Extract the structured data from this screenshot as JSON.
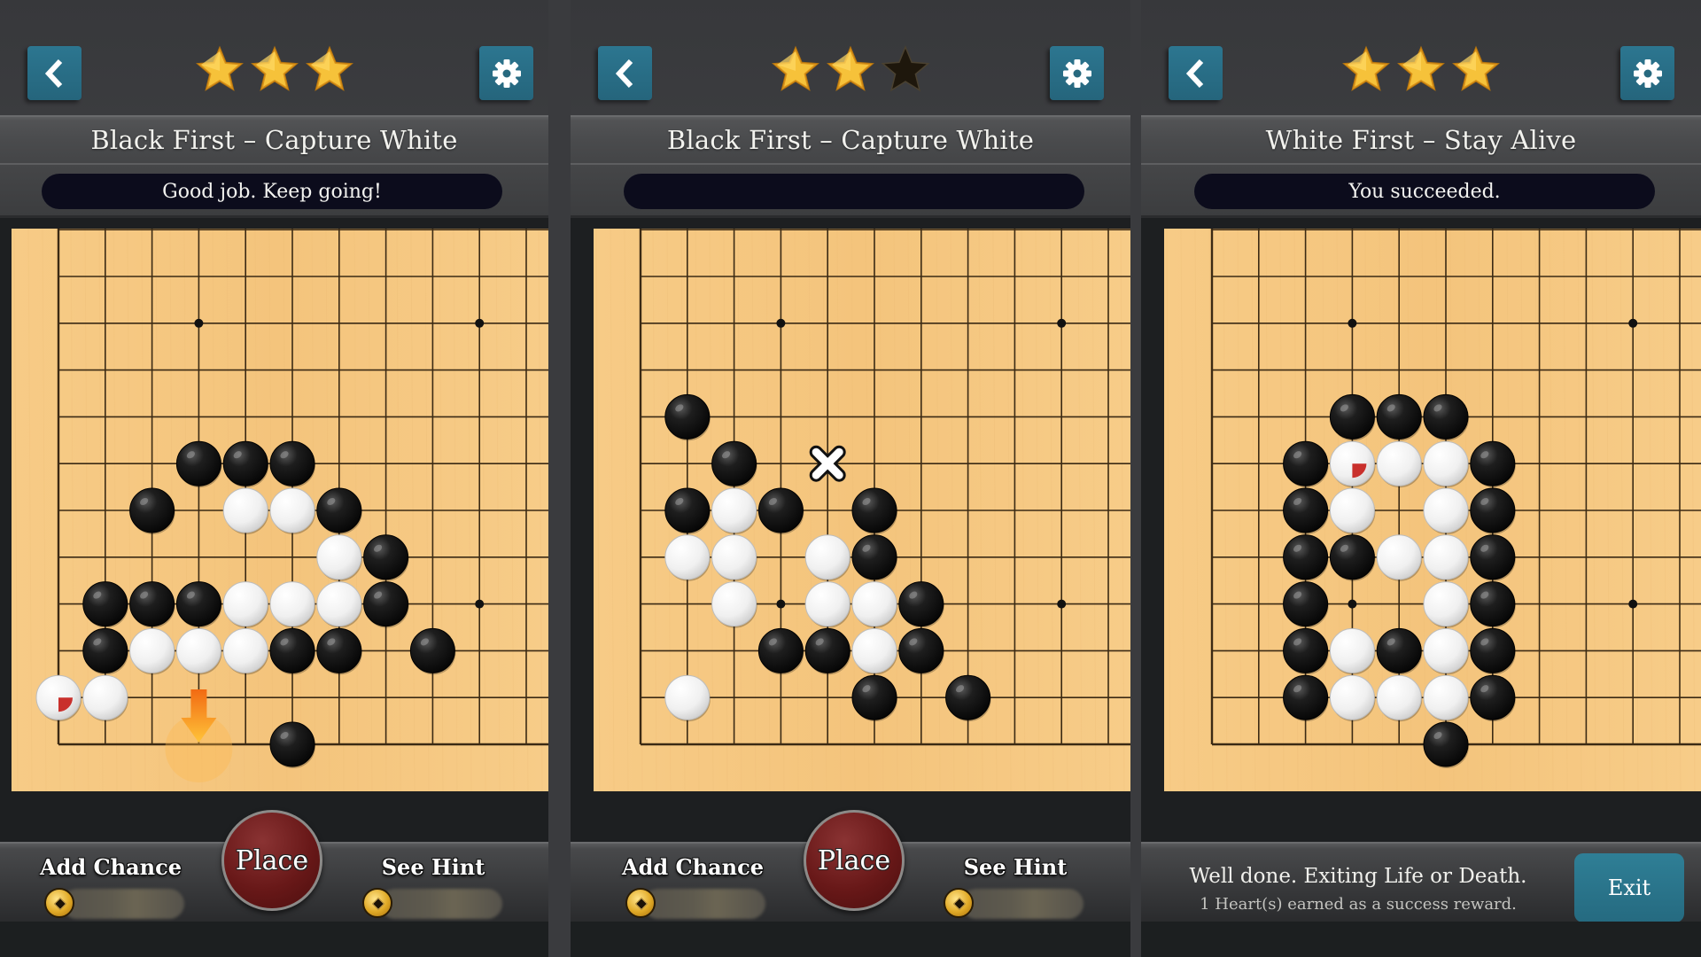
{
  "colors": {
    "accent_button": "#2a6f88",
    "place_button": "#681818",
    "board_wood": "#f6c982",
    "message_pill": "#0c0c1c",
    "star_gold": "#f3b52b",
    "star_empty": "#1e170c"
  },
  "board_size_visible": {
    "columns": 11,
    "rows": 12
  },
  "panels": [
    {
      "back_icon": "chevron-left-icon",
      "settings_icon": "gear-icon",
      "stars": {
        "earned": 3,
        "total": 3
      },
      "title": "Black First – Capture White",
      "message": "Good job. Keep going!",
      "star_points": [
        [
          3,
          9
        ],
        [
          9,
          9
        ],
        [
          9,
          3
        ]
      ],
      "stones": [
        {
          "color": "black",
          "col": 3,
          "row": 6
        },
        {
          "color": "black",
          "col": 4,
          "row": 6
        },
        {
          "color": "black",
          "col": 5,
          "row": 6
        },
        {
          "color": "black",
          "col": 2,
          "row": 5
        },
        {
          "color": "white",
          "col": 4,
          "row": 5
        },
        {
          "color": "white",
          "col": 5,
          "row": 5
        },
        {
          "color": "black",
          "col": 6,
          "row": 5
        },
        {
          "color": "white",
          "col": 6,
          "row": 4
        },
        {
          "color": "black",
          "col": 7,
          "row": 4
        },
        {
          "color": "black",
          "col": 1,
          "row": 3
        },
        {
          "color": "black",
          "col": 2,
          "row": 3
        },
        {
          "color": "black",
          "col": 3,
          "row": 3
        },
        {
          "color": "white",
          "col": 4,
          "row": 3
        },
        {
          "color": "white",
          "col": 5,
          "row": 3
        },
        {
          "color": "white",
          "col": 6,
          "row": 3
        },
        {
          "color": "black",
          "col": 7,
          "row": 3
        },
        {
          "color": "black",
          "col": 1,
          "row": 2
        },
        {
          "color": "white",
          "col": 2,
          "row": 2
        },
        {
          "color": "white",
          "col": 3,
          "row": 2
        },
        {
          "color": "white",
          "col": 4,
          "row": 2
        },
        {
          "color": "black",
          "col": 5,
          "row": 2
        },
        {
          "color": "black",
          "col": 6,
          "row": 2
        },
        {
          "color": "black",
          "col": 8,
          "row": 2
        },
        {
          "color": "white",
          "col": 0,
          "row": 1,
          "last_move": true
        },
        {
          "color": "white",
          "col": 1,
          "row": 1
        },
        {
          "color": "black",
          "col": 5,
          "row": 0
        }
      ],
      "markers": [
        {
          "type": "hint-arrow",
          "col": 3,
          "row": 0
        }
      ],
      "controls": {
        "add_chance_label": "Add Chance",
        "place_label": "Place",
        "see_hint_label": "See Hint"
      }
    },
    {
      "back_icon": "chevron-left-icon",
      "settings_icon": "gear-icon",
      "stars": {
        "earned": 2,
        "total": 3
      },
      "title": "Black First – Capture White",
      "message": "",
      "star_points": [
        [
          3,
          9
        ],
        [
          9,
          9
        ],
        [
          3,
          3
        ],
        [
          9,
          3
        ]
      ],
      "stones": [
        {
          "color": "black",
          "col": 1,
          "row": 7
        },
        {
          "color": "black",
          "col": 2,
          "row": 6
        },
        {
          "color": "black",
          "col": 1,
          "row": 5
        },
        {
          "color": "white",
          "col": 2,
          "row": 5
        },
        {
          "color": "black",
          "col": 3,
          "row": 5
        },
        {
          "color": "black",
          "col": 5,
          "row": 5
        },
        {
          "color": "white",
          "col": 1,
          "row": 4
        },
        {
          "color": "white",
          "col": 2,
          "row": 4
        },
        {
          "color": "white",
          "col": 4,
          "row": 4
        },
        {
          "color": "black",
          "col": 5,
          "row": 4
        },
        {
          "color": "white",
          "col": 2,
          "row": 3
        },
        {
          "color": "white",
          "col": 4,
          "row": 3
        },
        {
          "color": "white",
          "col": 5,
          "row": 3
        },
        {
          "color": "black",
          "col": 6,
          "row": 3
        },
        {
          "color": "black",
          "col": 3,
          "row": 2
        },
        {
          "color": "black",
          "col": 4,
          "row": 2
        },
        {
          "color": "white",
          "col": 5,
          "row": 2
        },
        {
          "color": "black",
          "col": 6,
          "row": 2
        },
        {
          "color": "white",
          "col": 1,
          "row": 1
        },
        {
          "color": "black",
          "col": 5,
          "row": 1
        },
        {
          "color": "black",
          "col": 7,
          "row": 1
        }
      ],
      "markers": [
        {
          "type": "wrong-x",
          "col": 4,
          "row": 6
        }
      ],
      "controls": {
        "add_chance_label": "Add Chance",
        "place_label": "Place",
        "see_hint_label": "See Hint"
      }
    },
    {
      "back_icon": "chevron-left-icon",
      "settings_icon": "gear-icon",
      "stars": {
        "earned": 3,
        "total": 3
      },
      "title": "White First – Stay Alive",
      "message": "You succeeded.",
      "star_points": [
        [
          3,
          9
        ],
        [
          9,
          9
        ],
        [
          3,
          3
        ],
        [
          9,
          3
        ]
      ],
      "stones": [
        {
          "color": "black",
          "col": 3,
          "row": 7
        },
        {
          "color": "black",
          "col": 4,
          "row": 7
        },
        {
          "color": "black",
          "col": 5,
          "row": 7
        },
        {
          "color": "black",
          "col": 2,
          "row": 6
        },
        {
          "color": "white",
          "col": 3,
          "row": 6,
          "last_move": true
        },
        {
          "color": "white",
          "col": 4,
          "row": 6
        },
        {
          "color": "white",
          "col": 5,
          "row": 6
        },
        {
          "color": "black",
          "col": 6,
          "row": 6
        },
        {
          "color": "black",
          "col": 2,
          "row": 5
        },
        {
          "color": "white",
          "col": 3,
          "row": 5
        },
        {
          "color": "white",
          "col": 5,
          "row": 5
        },
        {
          "color": "black",
          "col": 6,
          "row": 5
        },
        {
          "color": "black",
          "col": 2,
          "row": 4
        },
        {
          "color": "black",
          "col": 3,
          "row": 4
        },
        {
          "color": "white",
          "col": 4,
          "row": 4
        },
        {
          "color": "white",
          "col": 5,
          "row": 4
        },
        {
          "color": "black",
          "col": 6,
          "row": 4
        },
        {
          "color": "black",
          "col": 2,
          "row": 3
        },
        {
          "color": "white",
          "col": 5,
          "row": 3
        },
        {
          "color": "black",
          "col": 6,
          "row": 3
        },
        {
          "color": "black",
          "col": 2,
          "row": 2
        },
        {
          "color": "white",
          "col": 3,
          "row": 2
        },
        {
          "color": "black",
          "col": 4,
          "row": 2
        },
        {
          "color": "white",
          "col": 5,
          "row": 2
        },
        {
          "color": "black",
          "col": 6,
          "row": 2
        },
        {
          "color": "black",
          "col": 2,
          "row": 1
        },
        {
          "color": "white",
          "col": 3,
          "row": 1
        },
        {
          "color": "white",
          "col": 4,
          "row": 1
        },
        {
          "color": "white",
          "col": 5,
          "row": 1
        },
        {
          "color": "black",
          "col": 6,
          "row": 1
        },
        {
          "color": "black",
          "col": 5,
          "row": 0
        }
      ],
      "markers": [],
      "result": {
        "title": "Well done. Exiting Life or Death.",
        "subtitle": "1 Heart(s) earned as a success reward.",
        "exit_label": "Exit"
      }
    }
  ]
}
